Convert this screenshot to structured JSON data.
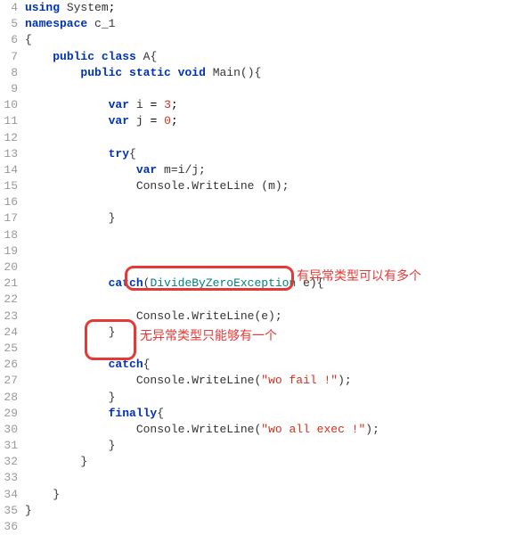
{
  "gutter": {
    "start": 4,
    "end": 36
  },
  "code": {
    "l4_using": "using",
    "l4_system": "System",
    "l5_namespace": "namespace",
    "l5_name": "c_1",
    "l6": "{",
    "l7_public": "public",
    "l7_class": "class",
    "l7_name": "A",
    "l7_brace": "{",
    "l8_public": "public",
    "l8_static": "static",
    "l8_void": "void",
    "l8_main": "Main",
    "l8_paren": "(){",
    "l10_var": "var",
    "l10_i": "i",
    "l10_eq": "=",
    "l10_val": "3",
    "l11_var": "var",
    "l11_j": "j",
    "l11_eq": "=",
    "l11_val": "0",
    "l13_try": "try",
    "l13_brace": "{",
    "l14_var": "var",
    "l14_expr": "m=i/j;",
    "l15_console": "Console.WriteLine",
    "l15_arg": "(m);",
    "l17_close": "}",
    "l21_catch": "catch",
    "l21_paren_o": "(",
    "l21_type": "DivideByZeroException",
    "l21_e": "e",
    "l21_paren_c": ")",
    "l21_brace": "{",
    "l23_console": "Console.WriteLine",
    "l23_arg": "(e);",
    "l24_close": "}",
    "l26_catch": "catch",
    "l26_brace": "{",
    "l27_console": "Console.WriteLine",
    "l27_paren_o": "(",
    "l27_str": "\"wo fail !\"",
    "l27_paren_c": ");",
    "l28_close": "}",
    "l29_finally": "finally",
    "l29_brace": "{",
    "l30_console": "Console.WriteLine",
    "l30_paren_o": "(",
    "l30_str": "\"wo all exec !\"",
    "l30_paren_c": ");",
    "l31_close": "}",
    "l32_close": "}",
    "l34_close": "}",
    "l35_close": "}"
  },
  "annotations": {
    "label1": "有异常类型可以有多个",
    "label2": "无异常类型只能够有一个"
  }
}
